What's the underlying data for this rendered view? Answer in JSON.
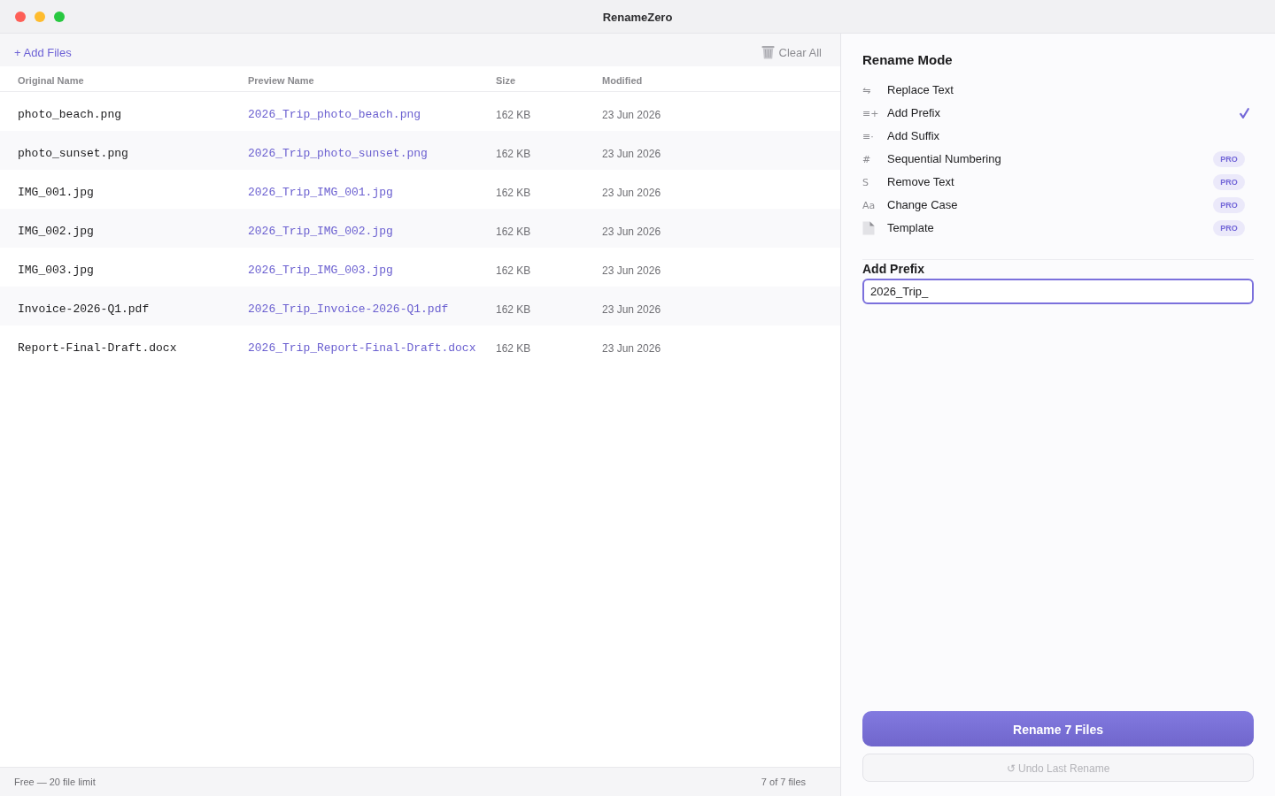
{
  "window": {
    "title": "RenameZero"
  },
  "toolbar": {
    "add_files": "+ Add Files",
    "clear_all": "Clear All"
  },
  "table": {
    "columns": [
      "Original Name",
      "Preview Name",
      "Size",
      "Modified"
    ],
    "rows": [
      {
        "original": "photo_beach.png",
        "preview": "2026_Trip_photo_beach.png",
        "size": "162 KB",
        "modified": "23 Jun 2026"
      },
      {
        "original": "photo_sunset.png",
        "preview": "2026_Trip_photo_sunset.png",
        "size": "162 KB",
        "modified": "23 Jun 2026"
      },
      {
        "original": "IMG_001.jpg",
        "preview": "2026_Trip_IMG_001.jpg",
        "size": "162 KB",
        "modified": "23 Jun 2026"
      },
      {
        "original": "IMG_002.jpg",
        "preview": "2026_Trip_IMG_002.jpg",
        "size": "162 KB",
        "modified": "23 Jun 2026"
      },
      {
        "original": "IMG_003.jpg",
        "preview": "2026_Trip_IMG_003.jpg",
        "size": "162 KB",
        "modified": "23 Jun 2026"
      },
      {
        "original": "Invoice-2026-Q1.pdf",
        "preview": "2026_Trip_Invoice-2026-Q1.pdf",
        "size": "162 KB",
        "modified": "23 Jun 2026"
      },
      {
        "original": "Report-Final-Draft.docx",
        "preview": "2026_Trip_Report-Final-Draft.docx",
        "size": "162 KB",
        "modified": "23 Jun 2026"
      }
    ]
  },
  "status_bar": {
    "plan": "Free — 20 file limit",
    "count": "7 of 7 files"
  },
  "rename_mode": {
    "title": "Rename Mode",
    "modes": [
      {
        "kind": "glyph",
        "glyph": "⇋",
        "label": "Replace Text",
        "selected": false
      },
      {
        "kind": "glyph",
        "glyph": "≡+",
        "label": "Add Prefix",
        "selected": true
      },
      {
        "kind": "glyph",
        "glyph": "≡·",
        "label": "Add Suffix",
        "selected": false
      },
      {
        "kind": "glyph",
        "glyph": "#",
        "label": "Sequential Numbering",
        "selected": false,
        "badge": "PRO"
      },
      {
        "kind": "glyph",
        "glyph": "S",
        "label": "Remove Text",
        "selected": false,
        "badge": "PRO"
      },
      {
        "kind": "glyph",
        "glyph": "Aa",
        "label": "Change Case",
        "selected": false,
        "badge": "PRO"
      },
      {
        "kind": "document",
        "label": "Template",
        "selected": false,
        "badge": "PRO"
      }
    ]
  },
  "prefix": {
    "label": "Add Prefix",
    "value": "2026_Trip_"
  },
  "rename_button": {
    "label": "Rename 7 Files"
  },
  "undo_button": {
    "label": "↺ Undo Last Rename",
    "disabled": true
  }
}
